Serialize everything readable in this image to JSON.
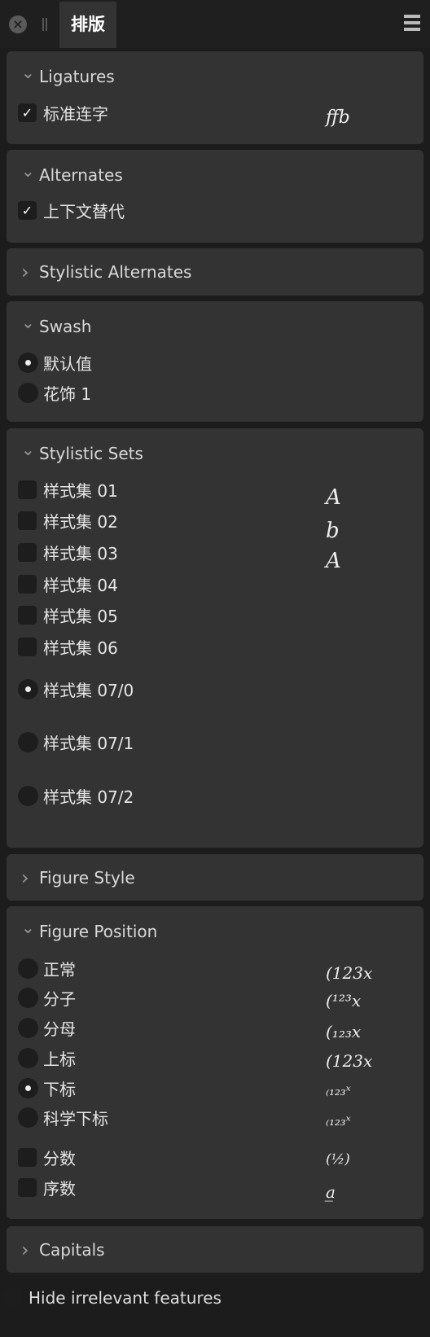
{
  "header": {
    "tab_label": "排版",
    "close_icon": "close-icon",
    "menu_icon": "hamburger-menu-icon"
  },
  "sections": [
    {
      "title": "Ligatures",
      "expanded": true,
      "items": [
        {
          "type": "checkbox",
          "label": "标准连字",
          "checked": true
        }
      ],
      "previews": [
        "ﬀb"
      ]
    },
    {
      "title": "Alternates",
      "expanded": true,
      "items": [
        {
          "type": "checkbox",
          "label": "上下文替代",
          "checked": true
        }
      ],
      "previews": []
    },
    {
      "title": "Stylistic Alternates",
      "expanded": false,
      "items": [],
      "previews": []
    },
    {
      "title": "Swash",
      "expanded": true,
      "items": [
        {
          "type": "radio",
          "label": "默认值",
          "checked": true
        },
        {
          "type": "radio",
          "label": "花饰 1",
          "checked": false
        }
      ],
      "previews": []
    },
    {
      "title": "Stylistic Sets",
      "expanded": true,
      "items": [
        {
          "type": "checkbox",
          "label": "样式集 01",
          "checked": false
        },
        {
          "type": "checkbox",
          "label": "样式集 02",
          "checked": false
        },
        {
          "type": "checkbox",
          "label": "样式集 03",
          "checked": false
        },
        {
          "type": "checkbox",
          "label": "样式集 04",
          "checked": false
        },
        {
          "type": "checkbox",
          "label": "样式集 05",
          "checked": false
        },
        {
          "type": "checkbox",
          "label": "样式集 06",
          "checked": false
        },
        {
          "type": "radio",
          "label": "样式集 07/0",
          "checked": true
        },
        {
          "type": "radio",
          "label": "样式集 07/1",
          "checked": false
        },
        {
          "type": "radio",
          "label": "样式集 07/2",
          "checked": false
        }
      ],
      "previews": [
        "A",
        "b",
        "A"
      ]
    },
    {
      "title": "Figure Style",
      "expanded": false,
      "items": [],
      "previews": []
    },
    {
      "title": "Figure Position",
      "expanded": true,
      "items": [
        {
          "type": "radio",
          "label": "正常",
          "checked": false
        },
        {
          "type": "radio",
          "label": "分子",
          "checked": false
        },
        {
          "type": "radio",
          "label": "分母",
          "checked": false
        },
        {
          "type": "radio",
          "label": "上标",
          "checked": false
        },
        {
          "type": "radio",
          "label": "下标",
          "checked": true
        },
        {
          "type": "radio",
          "label": "科学下标",
          "checked": false
        },
        {
          "type": "checkbox",
          "label": "分数",
          "checked": false
        },
        {
          "type": "checkbox",
          "label": "序数",
          "checked": false
        }
      ],
      "previews": [
        "(123x",
        "(¹²³x",
        "(₁₂₃x",
        "(123x",
        "₍₁₂₃ˣ",
        "₍₁₂₃ˣ",
        "(½)",
        "a̲"
      ]
    },
    {
      "title": "Capitals",
      "expanded": false,
      "items": [],
      "previews": []
    }
  ],
  "footer": {
    "label": "Hide irrelevant features",
    "checked": false
  }
}
